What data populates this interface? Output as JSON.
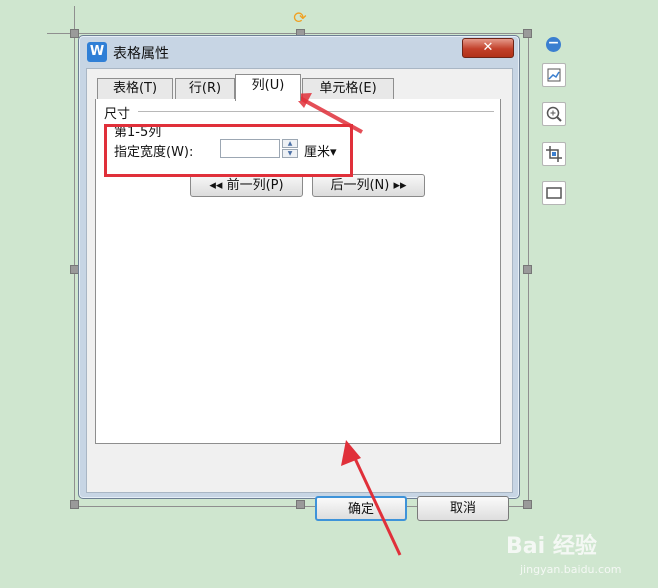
{
  "dialog": {
    "app_icon_glyph": "W",
    "title": "表格属性",
    "close_glyph": "✕",
    "tabs": [
      {
        "label": "表格(T)"
      },
      {
        "label": "行(R)"
      },
      {
        "label": "列(U)"
      },
      {
        "label": "单元格(E)"
      }
    ],
    "active_tab_index": 2,
    "size_group": {
      "label": "尺寸",
      "columns_range": "第1-5列",
      "width_label": "指定宽度(W):",
      "width_value": "",
      "unit": "厘米▾"
    },
    "prev_button": "◂◂ 前一列(P)",
    "next_button": "后一列(N) ▸▸",
    "ok_button": "确定",
    "cancel_button": "取消"
  },
  "side_toolbar": {
    "icons": [
      "collapse-icon",
      "chart-layout-icon",
      "zoom-in-icon",
      "crop-icon",
      "border-icon"
    ]
  },
  "watermark": {
    "brand": "Bai 经验",
    "url": "jingyan.baidu.com"
  },
  "colors": {
    "background": "#cfe6cf",
    "annotation_red": "#e0303a",
    "accent_blue": "#3e93d9"
  }
}
